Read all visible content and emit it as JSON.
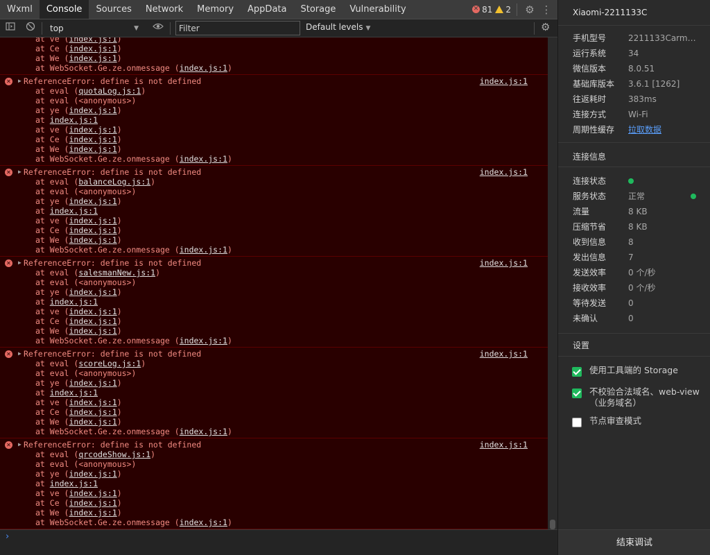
{
  "tabs": [
    {
      "label": "Wxml"
    },
    {
      "label": "Console",
      "active": true
    },
    {
      "label": "Sources"
    },
    {
      "label": "Network"
    },
    {
      "label": "Memory"
    },
    {
      "label": "AppData"
    },
    {
      "label": "Storage"
    },
    {
      "label": "Vulnerability"
    }
  ],
  "counts": {
    "errors": "81",
    "warnings": "2"
  },
  "toolbar": {
    "context": "top",
    "filter_placeholder": "Filter",
    "levels": "Default levels"
  },
  "partial_entry": {
    "frames": [
      {
        "prefix": "at ve (",
        "link": "index.js:1",
        "suffix": ")"
      },
      {
        "prefix": "at Ce (",
        "link": "index.js:1",
        "suffix": ")"
      },
      {
        "prefix": "at We (",
        "link": "index.js:1",
        "suffix": ")"
      },
      {
        "prefix": "at WebSocket.Ge.ze.onmessage (",
        "link": "index.js:1",
        "suffix": ")"
      }
    ]
  },
  "entries": [
    {
      "message": "ReferenceError: define is not defined",
      "source": "index.js:1",
      "file": "quotaLog.js:1"
    },
    {
      "message": "ReferenceError: define is not defined",
      "source": "index.js:1",
      "file": "balanceLog.js:1"
    },
    {
      "message": "ReferenceError: define is not defined",
      "source": "index.js:1",
      "file": "salesmanNew.js:1"
    },
    {
      "message": "ReferenceError: define is not defined",
      "source": "index.js:1",
      "file": "scoreLog.js:1"
    },
    {
      "message": "ReferenceError: define is not defined",
      "source": "index.js:1",
      "file": "qrcodeShow.js:1"
    }
  ],
  "common_frames": [
    {
      "prefix": "at eval (",
      "link": "",
      "suffix": "<anonymous>)"
    },
    {
      "prefix": "at ye (",
      "link": "index.js:1",
      "suffix": ")"
    },
    {
      "prefix": "at ",
      "link": "index.js:1",
      "suffix": ""
    },
    {
      "prefix": "at ve (",
      "link": "index.js:1",
      "suffix": ")"
    },
    {
      "prefix": "at Ce (",
      "link": "index.js:1",
      "suffix": ")"
    },
    {
      "prefix": "at We (",
      "link": "index.js:1",
      "suffix": ")"
    },
    {
      "prefix": "at WebSocket.Ge.ze.onmessage (",
      "link": "index.js:1",
      "suffix": ")"
    }
  ],
  "panel": {
    "device_name": "Xiaomi-2211133C",
    "device_info": [
      {
        "key": "手机型号",
        "value": "2211133Carm64..."
      },
      {
        "key": "运行系统",
        "value": "34"
      },
      {
        "key": "微信版本",
        "value": "8.0.51"
      },
      {
        "key": "基础库版本",
        "value": "3.6.1 [1262]"
      },
      {
        "key": "往返耗时",
        "value": "383ms"
      },
      {
        "key": "连接方式",
        "value": "Wi-Fi"
      },
      {
        "key": "周期性缓存",
        "value": "拉取数据",
        "link": true
      }
    ],
    "connection_title": "连接信息",
    "connection": [
      {
        "key": "连接状态",
        "value": "",
        "dot": true
      },
      {
        "key": "服务状态",
        "value": "正常",
        "dot_right": true
      },
      {
        "key": "流量",
        "value": "8 KB"
      },
      {
        "key": "压缩节省",
        "value": "8 KB"
      },
      {
        "key": "收到信息",
        "value": "8"
      },
      {
        "key": "发出信息",
        "value": "7"
      },
      {
        "key": "发送效率",
        "value": "0 个/秒"
      },
      {
        "key": "接收效率",
        "value": "0 个/秒"
      },
      {
        "key": "等待发送",
        "value": "0"
      },
      {
        "key": "未确认",
        "value": "0"
      }
    ],
    "settings_title": "设置",
    "settings": [
      {
        "label": "使用工具端的 Storage",
        "checked": true
      },
      {
        "label": "不校验合法域名、web-view（业务域名）",
        "checked": true
      },
      {
        "label": "节点审查模式",
        "checked": false
      }
    ],
    "end_button": "结束调试"
  },
  "colors": {
    "error_bg": "#290000",
    "error_text": "#f28b82",
    "status_green": "#1fb95d",
    "link_blue": "#5a9df8"
  }
}
